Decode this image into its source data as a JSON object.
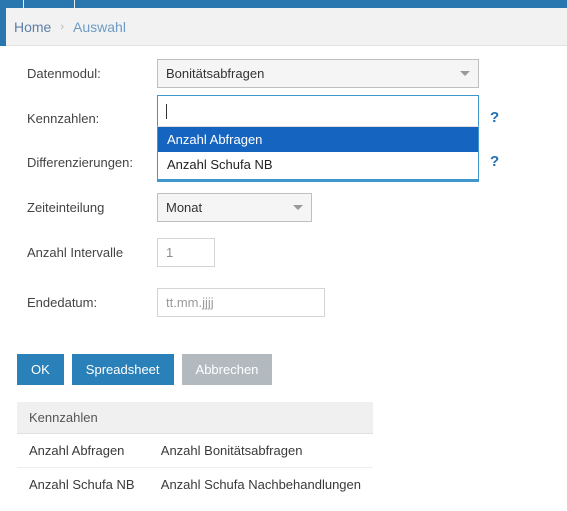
{
  "navbar": {
    "accent_color": "#2a76ae"
  },
  "breadcrumb": {
    "home_label": "Home",
    "separator": "›",
    "current_label": "Auswahl"
  },
  "form": {
    "rows": [
      {
        "label": "Datenmodul:",
        "value": "Bonitätsabfragen"
      },
      {
        "label": "Kennzahlen:",
        "value": ""
      },
      {
        "label": "Differenzierungen:",
        "value": ""
      },
      {
        "label": "Zeiteinteilung",
        "value": "Monat"
      },
      {
        "label": "Anzahl Intervalle",
        "value": "1"
      },
      {
        "label": "Endedatum:",
        "value": "",
        "placeholder": "tt.mm.jjjj"
      }
    ],
    "help_icon": "?"
  },
  "combobox": {
    "value": "",
    "options": [
      {
        "label": "Anzahl Abfragen",
        "selected": true
      },
      {
        "label": "Anzahl Schufa NB",
        "selected": false
      }
    ],
    "highlight_color": "#1565c0",
    "focus_border_color": "#3f97cd"
  },
  "buttons": {
    "ok": "OK",
    "spreadsheet": "Spreadsheet",
    "cancel": "Abbrechen",
    "primary_color": "#2a80b9",
    "disabled_color": "#b2bac0"
  },
  "table": {
    "header": "Kennzahlen",
    "rows": [
      {
        "key": "Anzahl Abfragen",
        "description": "Anzahl Bonitätsabfragen"
      },
      {
        "key": "Anzahl Schufa NB",
        "description": "Anzahl Schufa Nachbehandlungen"
      }
    ]
  }
}
